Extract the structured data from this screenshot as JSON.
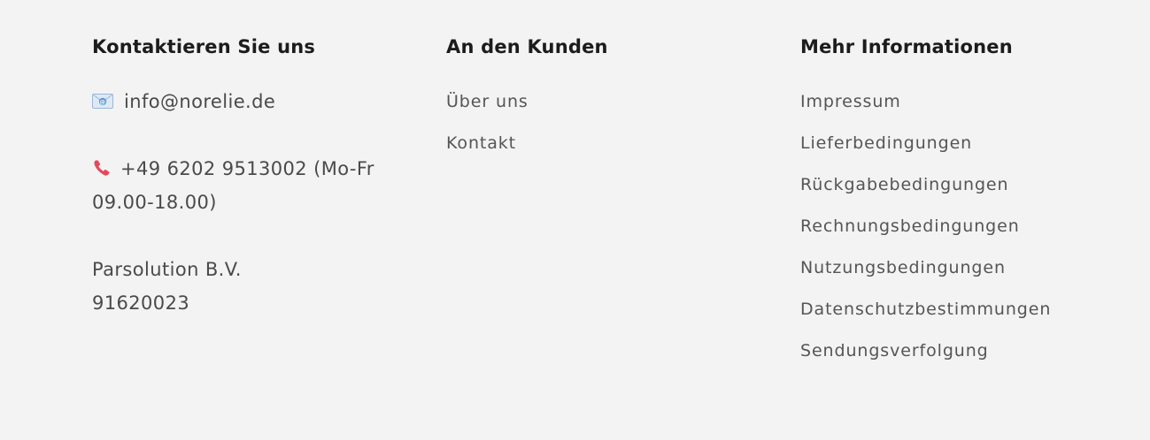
{
  "contact": {
    "heading": "Kontaktieren Sie uns",
    "email": "info@norelie.de",
    "email_icon": "envelope-icon",
    "phone_line1": "+49 6202 9513002 (Mo-Fr",
    "phone_line2": "09.00-18.00)",
    "phone_icon": "phone-icon",
    "company_name": "Parsolution B.V.",
    "company_number": "91620023"
  },
  "customer": {
    "heading": "An den Kunden",
    "links": [
      {
        "label": "Über uns"
      },
      {
        "label": "Kontakt"
      }
    ]
  },
  "info": {
    "heading": "Mehr Informationen",
    "links": [
      {
        "label": "Impressum"
      },
      {
        "label": "Lieferbedingungen"
      },
      {
        "label": "Rückgabebedingungen"
      },
      {
        "label": "Rechnungsbedingungen"
      },
      {
        "label": "Nutzungsbedingungen"
      },
      {
        "label": "Datenschutzbestimmungen"
      },
      {
        "label": "Sendungsverfolgung"
      }
    ]
  },
  "colors": {
    "background": "#f3f3f3",
    "heading": "#1c1c1c",
    "text": "#4a4a4a",
    "phone_icon": "#e8475b",
    "mail_icon": "#6fa8dc"
  }
}
